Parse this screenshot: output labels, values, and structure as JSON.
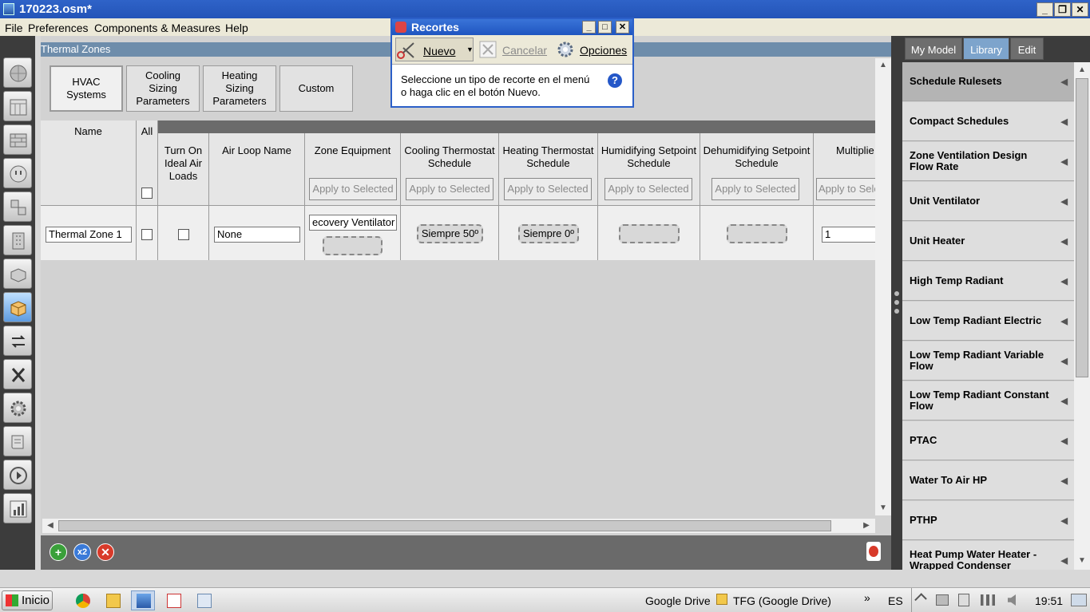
{
  "window": {
    "title": "170223.osm*",
    "minimize": "_",
    "maximize": "❐",
    "close": "✕"
  },
  "menu": [
    "File",
    "Preferences",
    "Components & Measures",
    "Help"
  ],
  "panel": {
    "title": "Thermal Zones"
  },
  "subtabs": [
    "HVAC Systems",
    "Cooling Sizing Parameters",
    "Heating Sizing Parameters",
    "Custom"
  ],
  "grid": {
    "headers": {
      "name": "Name",
      "all": "All",
      "turn_on": "Turn On Ideal Air Loads",
      "air_loop": "Air Loop Name",
      "zone_equipment": "Zone Equipment",
      "cooling_thermostat": "Cooling Thermostat Schedule",
      "heating_thermostat": "Heating Thermostat Schedule",
      "humidifying": "Humidifying Setpoint Schedule",
      "dehumidifying": "Dehumidifying Setpoint Schedule",
      "multiplier": "Multiplie"
    },
    "apply_label": "Apply to Selected",
    "apply_label_cut": "Apply to Sele",
    "row": {
      "name": "Thermal Zone 1",
      "air_loop": "None",
      "zone_equipment": "ecovery Ventilator",
      "cooling_schedule": "Siempre 50º",
      "heating_schedule": "Siempre 0º",
      "multiplier": "1"
    }
  },
  "right_tabs": [
    "My Model",
    "Library",
    "Edit"
  ],
  "library_items": [
    "Schedule Rulesets",
    "Compact Schedules",
    "Zone Ventilation Design Flow Rate",
    "Unit Ventilator",
    "Unit Heater",
    "High Temp Radiant",
    "Low Temp Radiant Electric",
    "Low Temp Radiant Variable Flow",
    "Low Temp Radiant Constant Flow",
    "PTAC",
    "Water To Air HP",
    "PTHP",
    "Heat Pump Water Heater - Wrapped Condenser"
  ],
  "library_arrow": "◀",
  "bottom_buttons": {
    "add": "+",
    "copy": "x2",
    "delete": "✕"
  },
  "popup": {
    "title": "Recortes",
    "new_label": "Nuevo",
    "cancel_label": "Cancelar",
    "options_label": "Opciones",
    "message": "Seleccione un tipo de recorte en el menú o haga clic en el botón Nuevo.",
    "help": "?"
  },
  "taskbar": {
    "start": "Inicio",
    "google_drive": "Google Drive",
    "tfg": "TFG (Google Drive)",
    "chevron": "»",
    "lang": "ES",
    "clock": "19:51"
  }
}
